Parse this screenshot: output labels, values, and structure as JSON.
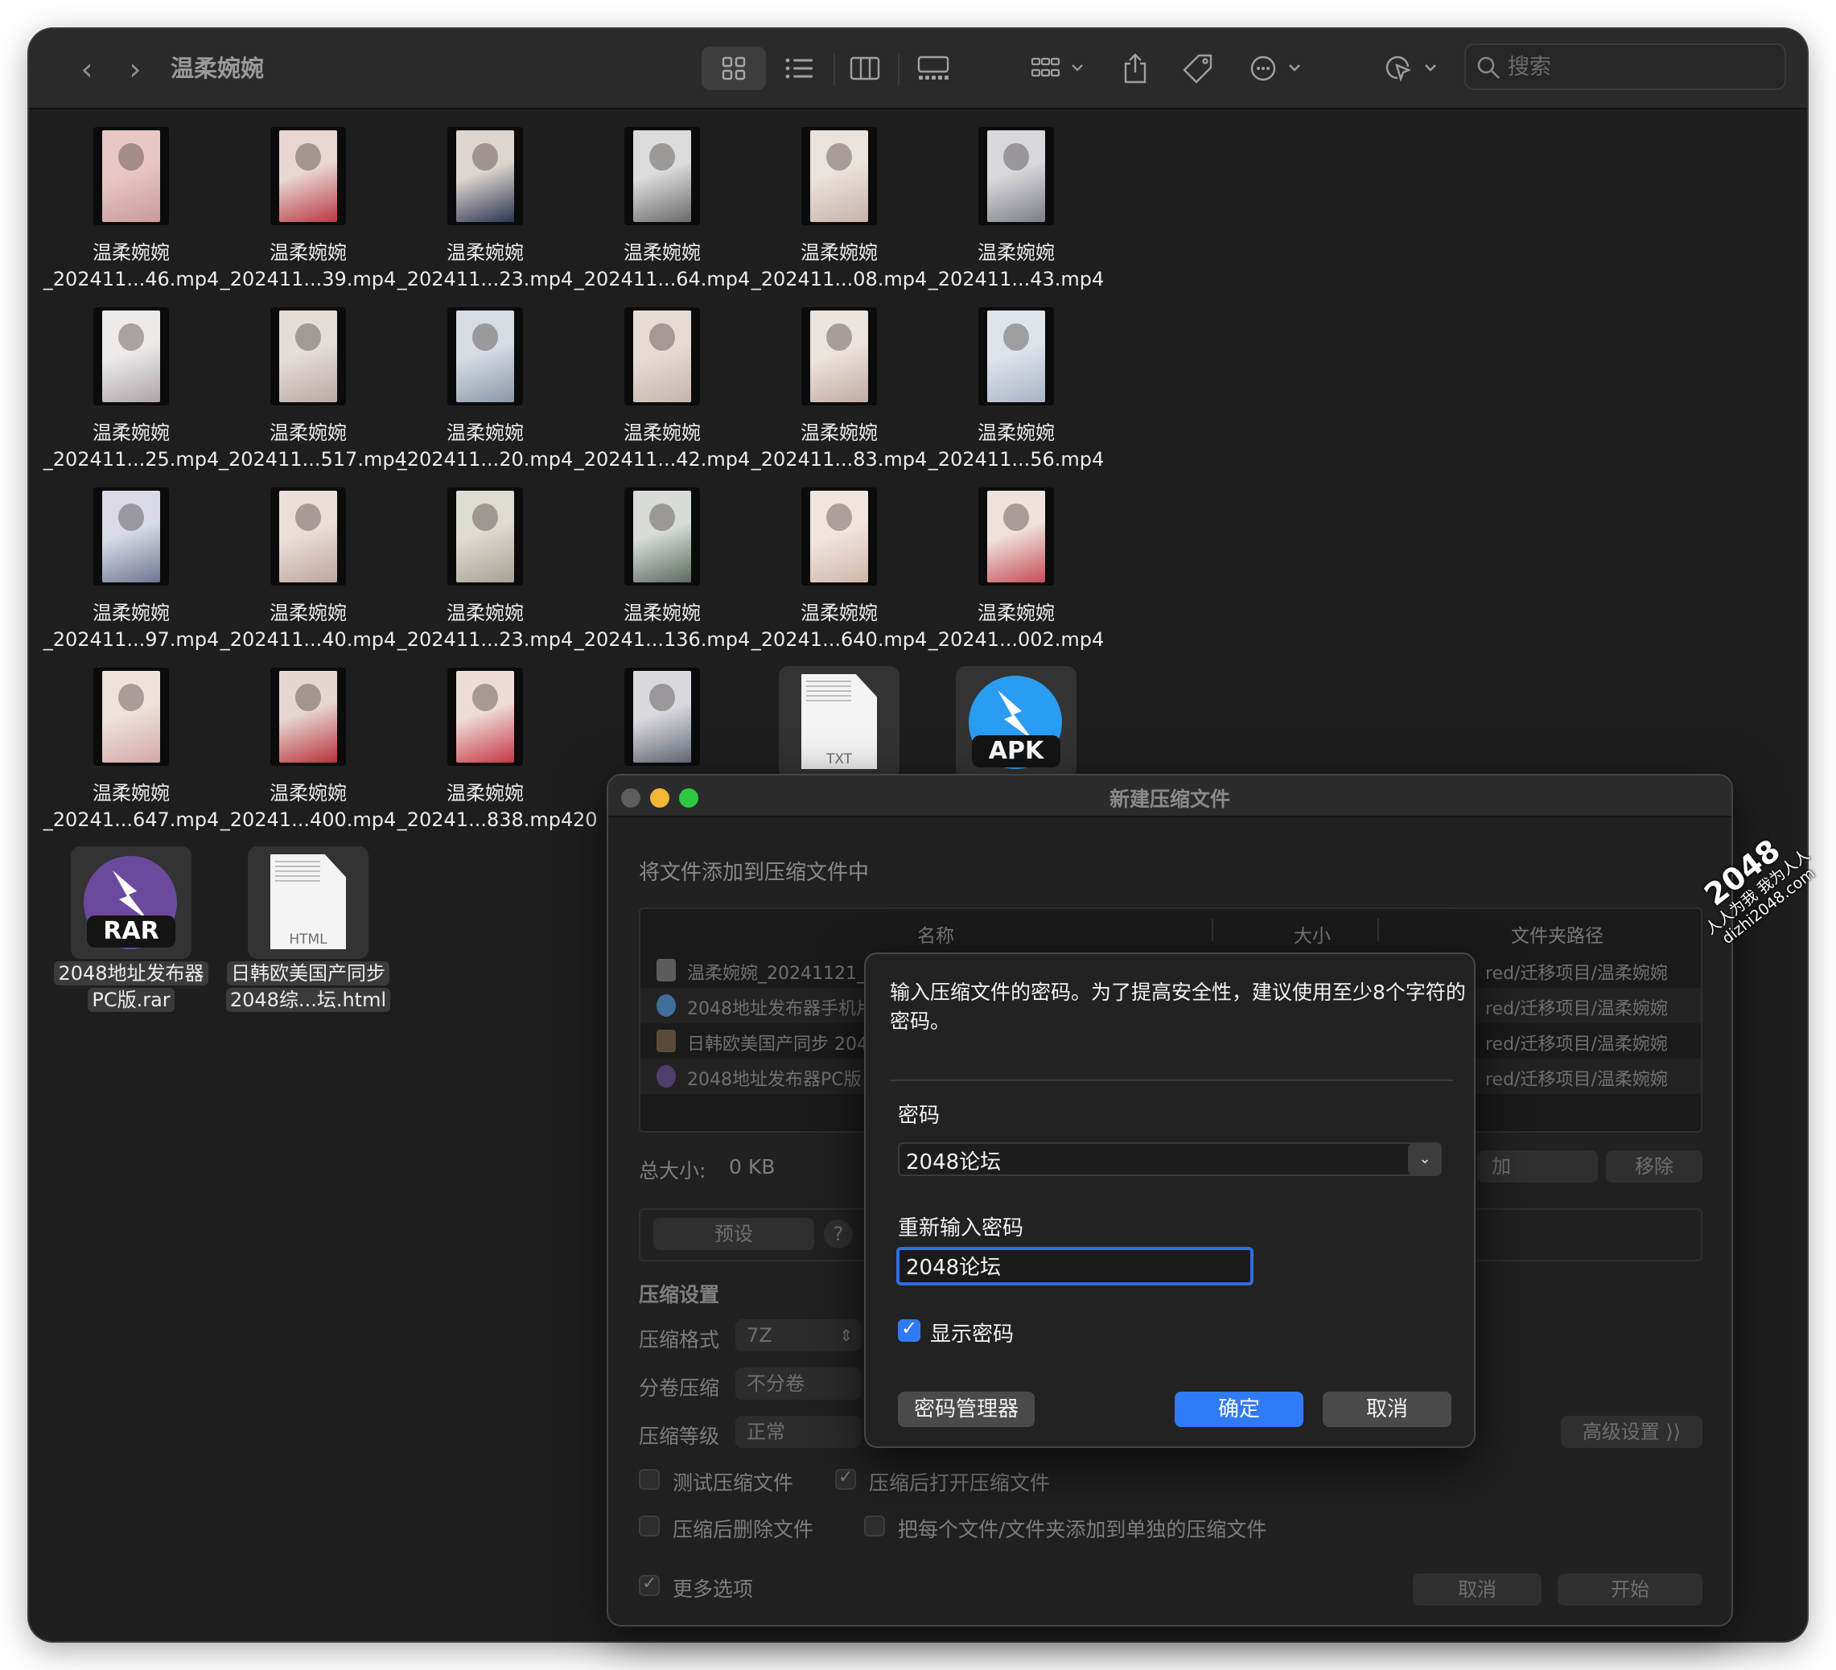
{
  "finder": {
    "title": "温柔婉婉",
    "search_placeholder": "搜索"
  },
  "files": [
    {
      "line1": "温柔婉婉",
      "line2": "_202411...46.mp4",
      "kind": "video",
      "colors": [
        "#e8c8c4",
        "#c99a98"
      ]
    },
    {
      "line1": "温柔婉婉",
      "line2": "_202411...39.mp4",
      "kind": "video",
      "colors": [
        "#e9d6d0",
        "#b73a45"
      ]
    },
    {
      "line1": "温柔婉婉",
      "line2": "_202411...23.mp4",
      "kind": "video",
      "colors": [
        "#ddd5cf",
        "#2c3450"
      ]
    },
    {
      "line1": "温柔婉婉",
      "line2": "_202411...64.mp4",
      "kind": "video",
      "colors": [
        "#dcdcdc",
        "#6a6a6a"
      ]
    },
    {
      "line1": "温柔婉婉",
      "line2": "_202411...08.mp4",
      "kind": "video",
      "colors": [
        "#eae2dc",
        "#c8b3a8"
      ]
    },
    {
      "line1": "温柔婉婉",
      "line2": "_202411...43.mp4",
      "kind": "video",
      "colors": [
        "#d8d8dc",
        "#7d7f86"
      ]
    },
    {
      "line1": "温柔婉婉",
      "line2": "_202411...25.mp4",
      "kind": "video",
      "colors": [
        "#eeeaea",
        "#aaa4a8"
      ]
    },
    {
      "line1": "温柔婉婉",
      "line2": "_202411...517.mp4",
      "kind": "video",
      "colors": [
        "#e4ddd8",
        "#b9aaa5"
      ]
    },
    {
      "line1": "温柔婉婉",
      "line2": "_202411...20.mp4",
      "kind": "video",
      "colors": [
        "#d7dce3",
        "#8a97a8"
      ]
    },
    {
      "line1": "温柔婉婉",
      "line2": "_202411...42.mp4",
      "kind": "video",
      "colors": [
        "#e6dcd6",
        "#c6b5ac"
      ]
    },
    {
      "line1": "温柔婉婉",
      "line2": "_202411...83.mp4",
      "kind": "video",
      "colors": [
        "#ece4de",
        "#c2aca2"
      ]
    },
    {
      "line1": "温柔婉婉",
      "line2": "_202411...56.mp4",
      "kind": "video",
      "colors": [
        "#dfe3ea",
        "#a9b4c6"
      ]
    },
    {
      "line1": "温柔婉婉",
      "line2": "_202411...97.mp4",
      "kind": "video",
      "colors": [
        "#d8dbe6",
        "#6f7692"
      ]
    },
    {
      "line1": "温柔婉婉",
      "line2": "_202411...40.mp4",
      "kind": "video",
      "colors": [
        "#eadfd9",
        "#bfa59b"
      ]
    },
    {
      "line1": "温柔婉婉",
      "line2": "_202411...23.mp4",
      "kind": "video",
      "colors": [
        "#dedbd3",
        "#a8a292"
      ]
    },
    {
      "line1": "温柔婉婉",
      "line2": "_20241...136.mp4",
      "kind": "video",
      "colors": [
        "#d8dcd8",
        "#5d6a60"
      ]
    },
    {
      "line1": "温柔婉婉",
      "line2": "_20241...640.mp4",
      "kind": "video",
      "colors": [
        "#f0e6e0",
        "#d2b6aa"
      ]
    },
    {
      "line1": "温柔婉婉",
      "line2": "_20241...002.mp4",
      "kind": "video",
      "colors": [
        "#efe2dc",
        "#c44e57"
      ]
    },
    {
      "line1": "温柔婉婉",
      "line2": "_20241...647.mp4",
      "kind": "video",
      "colors": [
        "#eee2dc",
        "#d3a9a6"
      ]
    },
    {
      "line1": "温柔婉婉",
      "line2": "_20241...400.mp4",
      "kind": "video",
      "colors": [
        "#e6d6d0",
        "#b8323c"
      ]
    },
    {
      "line1": "温柔婉婉",
      "line2": "_20241...838.mp4",
      "kind": "video",
      "colors": [
        "#eedcd6",
        "#c73746"
      ]
    },
    {
      "line1": "",
      "line2": "20",
      "kind": "video",
      "colors": [
        "#d9d9dd",
        "#6a6f7c"
      ]
    },
    {
      "line1": "",
      "line2": "",
      "kind": "txt",
      "ext": "TXT"
    },
    {
      "line1": "",
      "line2": "",
      "kind": "apk",
      "badge": "APK",
      "color": "#2a9df2"
    },
    {
      "line1": "2048地址发布器",
      "line2": "PC版.rar",
      "kind": "rar",
      "badge": "RAR",
      "color": "#6b4a9e",
      "boxed": true
    },
    {
      "line1": "日韩欧美国产同步",
      "line2": "2048综...坛.html",
      "kind": "html",
      "ext": "HTML",
      "boxed": true
    }
  ],
  "dialog": {
    "title": "新建压缩文件",
    "subhead": "将文件添加到压缩文件中",
    "columns": [
      "名称",
      "大小",
      "文件夹路径"
    ],
    "rows": [
      {
        "name": "温柔婉婉_20241121_0",
        "path": "red/迁移项目/温柔婉婉"
      },
      {
        "name": "2048地址发布器手机片",
        "path": "red/迁移项目/温柔婉婉"
      },
      {
        "name": "日韩欧美国产同步 204",
        "path": "red/迁移项目/温柔婉婉"
      },
      {
        "name": "2048地址发布器PC版",
        "path": "red/迁移项目/温柔婉婉"
      }
    ],
    "total_size_label": "总大小:",
    "total_size_value": "0 KB",
    "add_btn": "加",
    "remove_btn": "移除",
    "preset_btn": "预设",
    "help": "?",
    "compression_settings": "压缩设置",
    "format_label": "压缩格式",
    "format_value": "7Z",
    "split_label": "分卷压缩",
    "split_value": "不分卷",
    "level_label": "压缩等级",
    "level_value": "正常",
    "advanced_btn": "高级设置 ⟩⟩",
    "test_archive": "测试压缩文件",
    "open_after": "压缩后打开压缩文件",
    "delete_after": "压缩后删除文件",
    "separate_archives": "把每个文件/文件夹添加到单独的压缩文件",
    "more_options": "更多选项",
    "cancel_btn": "取消",
    "start_btn": "开始"
  },
  "password_sheet": {
    "message": "输入压缩文件的密码。为了提高安全性，建议使用至少8个字符的密码。",
    "password_label": "密码",
    "password_value": "2048论坛",
    "reenter_label": "重新输入密码",
    "reenter_value": "2048论坛",
    "show_password": "显示密码",
    "manager_btn": "密码管理器",
    "ok_btn": "确定",
    "cancel_btn": "取消"
  },
  "watermark": {
    "big": "2048",
    "line1": "人人为我 我为人人",
    "line2": "dizhi2048.com"
  }
}
